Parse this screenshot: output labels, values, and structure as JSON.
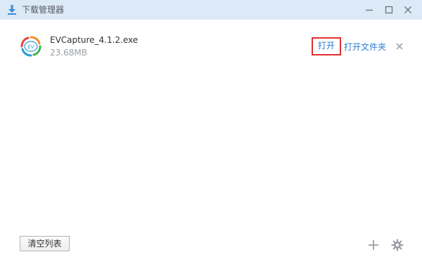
{
  "window": {
    "title": "下载管理器",
    "title_icon": "download-icon",
    "controls": [
      "minimize-icon",
      "maximize-icon",
      "close-icon"
    ]
  },
  "downloads": [
    {
      "file_name": "EVCapture_4.1.2.exe",
      "size": "23.68MB",
      "icon": "evcapture-app-icon",
      "open_label": "打开",
      "open_folder_label": "打开文件夹",
      "remove_icon": "close-icon"
    }
  ],
  "footer": {
    "clear_label": "清空列表",
    "add_icon": "plus-icon",
    "settings_icon": "gear-icon"
  },
  "colors": {
    "titlebar_bg": "#dce9f6",
    "link": "#2b7bd3",
    "highlight_border": "#e0302e",
    "accent_icon": "#3b8ad9"
  }
}
